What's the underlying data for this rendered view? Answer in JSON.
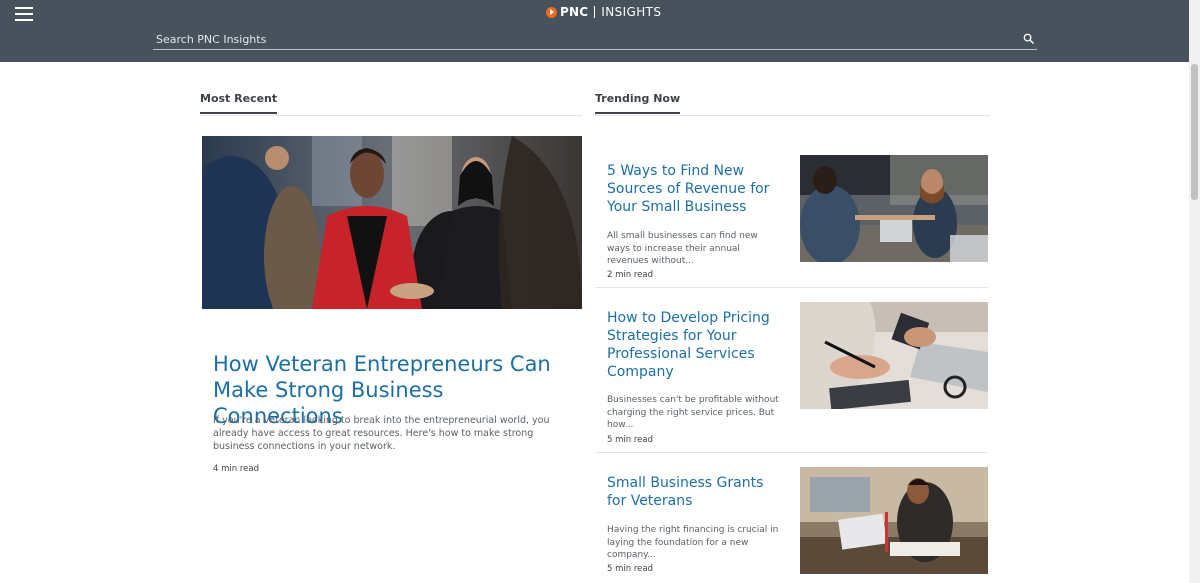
{
  "header": {
    "brand": "PNC",
    "brand_sub": "INSIGHTS",
    "search_placeholder": "Search PNC Insights",
    "menu_icon": "hamburger-menu-icon",
    "search_icon": "search-icon",
    "bg_color": "#47525c",
    "logo_color": "#ef6a21"
  },
  "most_recent": {
    "heading": "Most Recent",
    "feature": {
      "title": "How Veteran Entrepreneurs Can Make Strong Business Connections",
      "description": "If you're a veteran looking to break into the entrepreneurial world, you already have access to great resources. Here's how to make strong business connections in your network.",
      "read_time": "4 min read"
    }
  },
  "trending": {
    "heading": "Trending Now",
    "articles": [
      {
        "title": "5 Ways to Find New Sources of Revenue for Your Small Business",
        "description": "All small businesses can find new ways to increase their annual revenues without...",
        "read_time": "2 min read"
      },
      {
        "title": "How to Develop Pricing Strategies for Your Professional Services Company",
        "description": "Businesses can't be profitable without charging the right service prices. But how...",
        "read_time": "5 min read"
      },
      {
        "title": "Small Business Grants for Veterans",
        "description": "Having the right financing is crucial in laying the foundation for a new company...",
        "read_time": "5 min read"
      }
    ]
  },
  "colors": {
    "link_blue": "#1c6fa6",
    "text_gray": "#5a6167",
    "heading_dark": "#3d4348"
  }
}
